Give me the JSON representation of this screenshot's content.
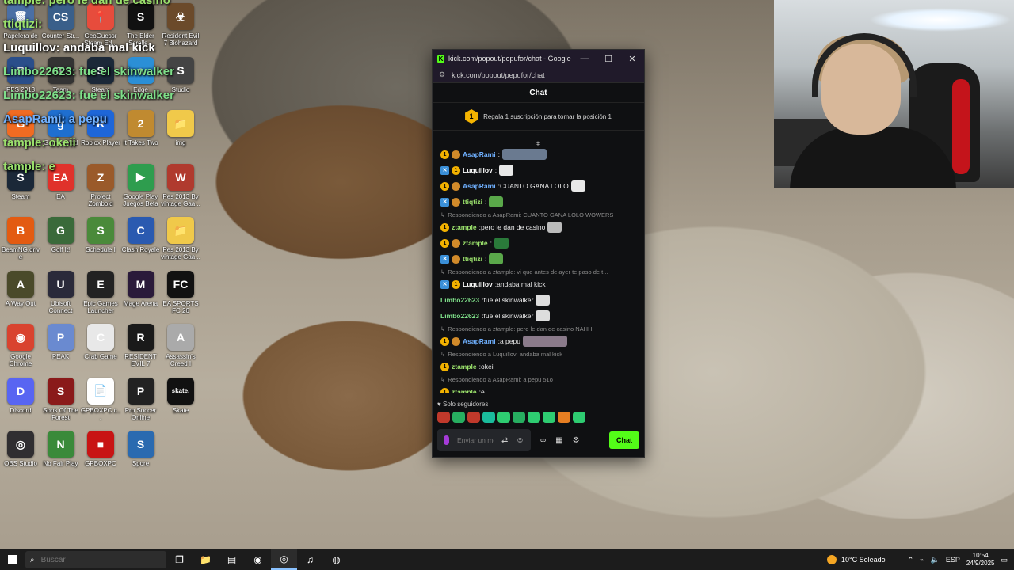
{
  "desktop": {
    "icons": [
      {
        "label": "Papelera de",
        "color": "#4a6fa5",
        "glyph": "🗑"
      },
      {
        "label": "Counter-Str...",
        "color": "#3a5f8a",
        "glyph": "CS"
      },
      {
        "label": "GeoGuessr Steam Ed...",
        "color": "#e74c3c",
        "glyph": "📍"
      },
      {
        "label": "The Elder Scrolls...",
        "color": "#111111",
        "glyph": "S"
      },
      {
        "label": "Resident Evil 7 Biohazard",
        "color": "#6b4a2a",
        "glyph": "☣"
      },
      {
        "label": "PES 2013",
        "color": "#2a4e8a",
        "glyph": "P"
      },
      {
        "label": "Team",
        "color": "#333333",
        "glyph": "T"
      },
      {
        "label": "Steam",
        "color": "#1b2838",
        "glyph": "S"
      },
      {
        "label": "Edge",
        "color": "#2b8fd6",
        "glyph": "e"
      },
      {
        "label": "Studio",
        "color": "#444444",
        "glyph": "S"
      },
      {
        "label": "GCC",
        "color": "#f16b22",
        "glyph": "G"
      },
      {
        "label": "Garry's Mod",
        "color": "#1f6fd0",
        "glyph": "g"
      },
      {
        "label": "Roblox Player",
        "color": "#1e66d8",
        "glyph": "R"
      },
      {
        "label": "It Takes Two",
        "color": "#c08a30",
        "glyph": "2"
      },
      {
        "label": "img",
        "color": "#f0c94a",
        "glyph": "📁"
      },
      {
        "label": "Steam",
        "color": "#1b2838",
        "glyph": "S"
      },
      {
        "label": "EA",
        "color": "#e0322b",
        "glyph": "EA"
      },
      {
        "label": "Project Zomboid",
        "color": "#9a5a2a",
        "glyph": "Z"
      },
      {
        "label": "Google Play Juegos Beta",
        "color": "#2e9d4e",
        "glyph": "▶"
      },
      {
        "label": "Pes 2013 By vintage Gaa...",
        "color": "#b03a2e",
        "glyph": "W"
      },
      {
        "label": "BeamNG.drive",
        "color": "#e35b12",
        "glyph": "B"
      },
      {
        "label": "Golf It!",
        "color": "#3a6a3a",
        "glyph": "G"
      },
      {
        "label": "Schedule I",
        "color": "#4a8a3a",
        "glyph": "S"
      },
      {
        "label": "Clash Royale",
        "color": "#2a5ab0",
        "glyph": "C"
      },
      {
        "label": "Pes 2013 By vintage Gaa...",
        "color": "#f0c94a",
        "glyph": "📁"
      },
      {
        "label": "A Way Out",
        "color": "#4a4a2a",
        "glyph": "A"
      },
      {
        "label": "Ubisoft Connect",
        "color": "#2a2a3a",
        "glyph": "U"
      },
      {
        "label": "Epic Games Launcher",
        "color": "#222222",
        "glyph": "E"
      },
      {
        "label": "Mage Arena",
        "color": "#2a1a3a",
        "glyph": "M"
      },
      {
        "label": "EA SPORTS FC 26",
        "color": "#111111",
        "glyph": "FC"
      },
      {
        "label": "Google Chrome",
        "color": "#d9432f",
        "glyph": "◉"
      },
      {
        "label": "PEAK",
        "color": "#6a8ad0",
        "glyph": "P"
      },
      {
        "label": "Crab Game",
        "color": "#e8e8e8",
        "glyph": "C"
      },
      {
        "label": "RESIDENT EVIL 7",
        "color": "#1a1a1a",
        "glyph": "R"
      },
      {
        "label": "Assassin's Creed I",
        "color": "#aaaaaa",
        "glyph": "A"
      },
      {
        "label": "Discord",
        "color": "#5865f2",
        "glyph": "D"
      },
      {
        "label": "Sons Of The Forest",
        "color": "#8a1a1a",
        "glyph": "S"
      },
      {
        "label": "GPBOXPC.c...",
        "color": "#ffffff",
        "glyph": "📄"
      },
      {
        "label": "Pro Soccer Online",
        "color": "#222222",
        "glyph": "P"
      },
      {
        "label": "Skate",
        "color": "#111111",
        "glyph": "skate."
      },
      {
        "label": "OBS Studio",
        "color": "#302e31",
        "glyph": "◎"
      },
      {
        "label": "No Fair Play",
        "color": "#3a8a3a",
        "glyph": "N"
      },
      {
        "label": "GPBOXPC",
        "color": "#c81414",
        "glyph": "■"
      },
      {
        "label": "Spore",
        "color": "#2a6ab0",
        "glyph": "S"
      }
    ]
  },
  "overlay_chat": [
    {
      "text": "tample: pero le dan de casino",
      "color": "#9be16c"
    },
    {
      "text": "ttiqtizi:",
      "color": "#9be16c"
    },
    {
      "text": "Luquillov: andaba mal kick",
      "color": "#ffffff"
    },
    {
      "text": "Limbo22623: fue el skinwalker",
      "color": "#7fe08a"
    },
    {
      "text": "Limbo22623: fue el skinwalker",
      "color": "#7fe08a"
    },
    {
      "text": "AsapRami: a pepu",
      "color": "#6fb0ff"
    },
    {
      "text": "tample: okeii",
      "color": "#9be16c"
    },
    {
      "text": "tample: e",
      "color": "#9be16c"
    }
  ],
  "window": {
    "title": "kick.com/popout/pepufor/chat - Google C...",
    "url": "kick.com/popout/pepufor/chat",
    "minimize": "—",
    "maximize": "☐",
    "close": "✕"
  },
  "chat": {
    "header": "Chat",
    "pinned_rank": "1",
    "pinned_text": "Regala 1 suscripción para tomar la posición 1",
    "followers_only": "Solo seguidores",
    "input_placeholder": "Enviar un mensaje",
    "send_label": "Chat",
    "messages": [
      {
        "badges": [
          "gold",
          "coin"
        ],
        "user": "AsapRami",
        "user_color": "#6fb0ff",
        "text": "",
        "emote_color": "#6a7a90",
        "emote_wide": true
      },
      {
        "badges": [
          "x",
          "gold"
        ],
        "user": "Luquillov",
        "user_color": "#ffffff",
        "text": "",
        "emote_color": "#e8e8e8",
        "emote_wide": false
      },
      {
        "badges": [
          "gold",
          "coin"
        ],
        "user": "AsapRami",
        "user_color": "#6fb0ff",
        "text": "CUANTO GANA LOLO",
        "emote_color": "#e8e8e8",
        "emote_wide": false
      },
      {
        "badges": [
          "x",
          "coin"
        ],
        "user": "ttiqtizi",
        "user_color": "#9be16c",
        "text": "",
        "emote_color": "#5aa84a",
        "emote_wide": false
      },
      {
        "reply": "Respondiendo a AsapRami: CUANTO GANA LOLO WOWERS",
        "badges": [
          "gold"
        ],
        "user": "ztample",
        "user_color": "#9be16c",
        "text": "pero le dan de casino",
        "emote_color": "#bbbbbb",
        "emote_wide": false
      },
      {
        "badges": [
          "gold",
          "coin"
        ],
        "user": "ztample",
        "user_color": "#9be16c",
        "text": "",
        "emote_color": "#2a7a3a",
        "emote_wide": false
      },
      {
        "badges": [
          "x",
          "coin"
        ],
        "user": "ttiqtizi",
        "user_color": "#9be16c",
        "text": "",
        "emote_color": "#5aa84a",
        "emote_wide": false
      },
      {
        "reply": "Respondiendo a ztample: vi que antes de ayer te paso de t...",
        "badges": [
          "x",
          "gold"
        ],
        "user": "Luquillov",
        "user_color": "#ffffff",
        "text": "andaba mal kick",
        "emote_color": "",
        "emote_wide": false
      },
      {
        "badges": [],
        "user": "Limbo22623",
        "user_color": "#7fe08a",
        "text": "fue el skinwalker",
        "emote_color": "#dddddd",
        "emote_wide": false
      },
      {
        "badges": [],
        "user": "Limbo22623",
        "user_color": "#7fe08a",
        "text": "fue el skinwalker",
        "emote_color": "#dddddd",
        "emote_wide": false
      },
      {
        "reply": "Respondiendo a ztample: pero le dan de casino NAHH",
        "badges": [
          "gold",
          "coin"
        ],
        "user": "AsapRami",
        "user_color": "#6fb0ff",
        "text": "a pepu",
        "emote_color": "#8a7a8a",
        "emote_wide": true
      },
      {
        "reply": "Respondiendo a Luquillov: andaba mal kick",
        "badges": [
          "gold"
        ],
        "user": "ztample",
        "user_color": "#9be16c",
        "text": "okeii",
        "emote_color": "",
        "emote_wide": false
      },
      {
        "reply": "Respondiendo a AsapRami: a pepu 51o",
        "badges": [
          "gold"
        ],
        "user": "ztample",
        "user_color": "#9be16c",
        "text": "e",
        "emote_color": "",
        "emote_wide": false
      }
    ],
    "emote_bar": [
      "#c0392b",
      "#27ae60",
      "#c0392b",
      "#1abc9c",
      "#2ecc71",
      "#27ae60",
      "#2ecc71",
      "#2ecc71",
      "#e67e22",
      "#2ecc71"
    ]
  },
  "taskbar": {
    "search_placeholder": "Buscar",
    "weather": "10°C  Soleado",
    "language": "ESP",
    "time": "10:54",
    "date": "24/9/2025"
  },
  "colors": {
    "kick_green": "#53fc18",
    "chat_bg": "#0f1012"
  }
}
